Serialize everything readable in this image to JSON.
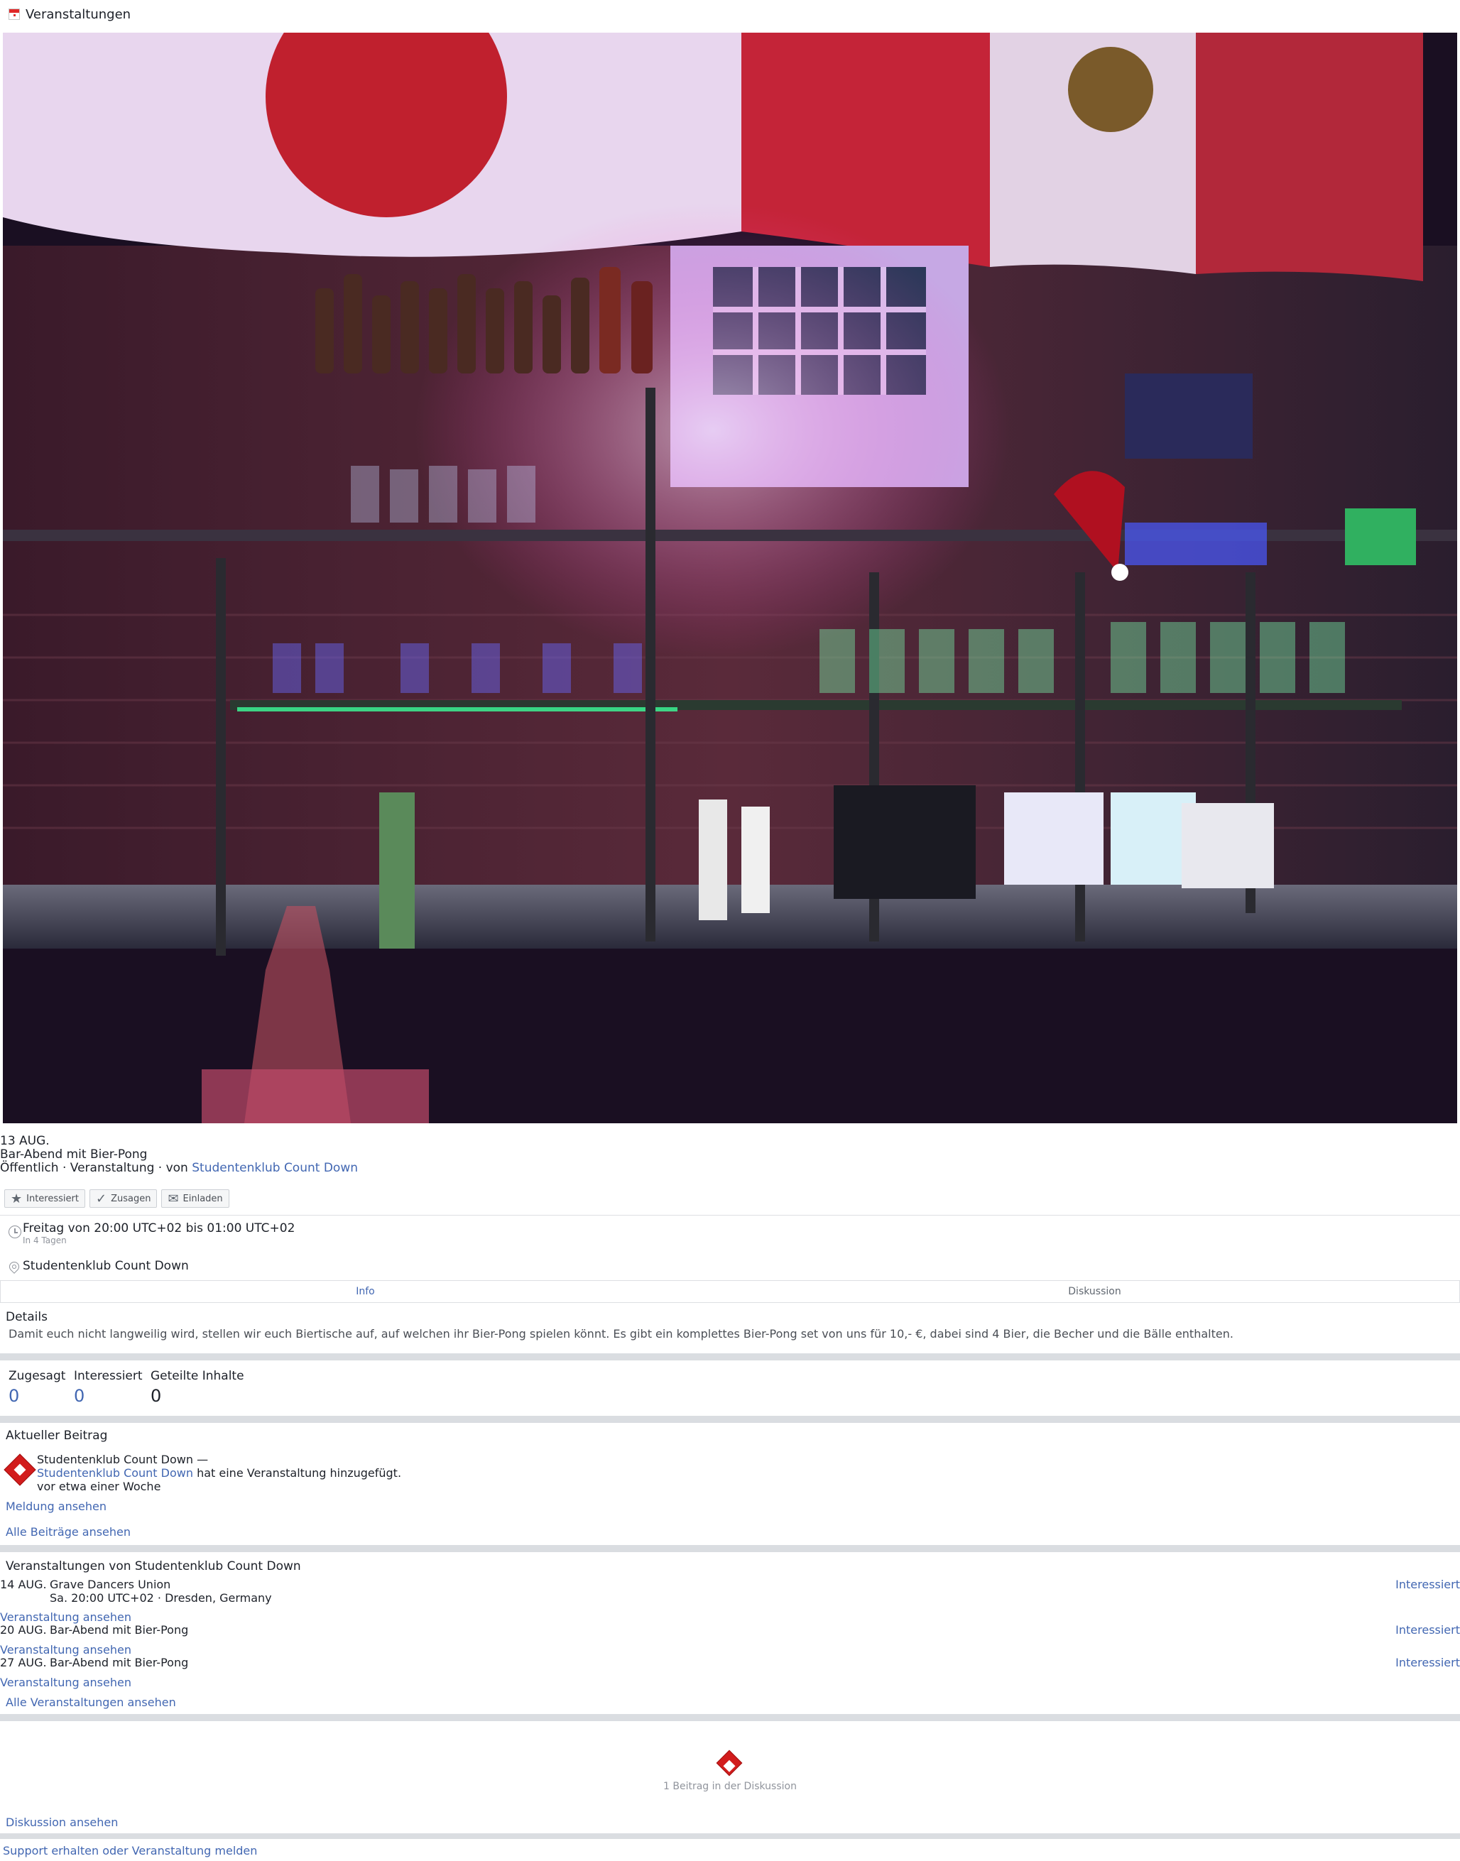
{
  "header": {
    "title": "Veranstaltungen",
    "icon": "calendar-icon"
  },
  "event": {
    "date": "13 AUG.",
    "title": "Bar-Abend mit Bier-Pong",
    "meta_prefix": "Öffentlich · Veranstaltung · von ",
    "organizer": "Studentenklub Count Down"
  },
  "actions": {
    "interested": "Interessiert",
    "going": "Zusagen",
    "invite": "Einladen"
  },
  "time": {
    "main": "Freitag von 20:00 UTC+02 bis 01:00 UTC+02",
    "relative": "In 4 Tagen"
  },
  "location": {
    "name": "Studentenklub Count Down"
  },
  "tabs": {
    "info": "Info",
    "discussion": "Diskussion"
  },
  "details": {
    "title": "Details",
    "text": "Damit euch nicht langweilig wird, stellen wir euch Biertische auf, auf welchen ihr Bier-Pong spielen könnt. Es gibt ein komplettes Bier-Pong set von uns für 10,- €, dabei sind 4 Bier, die Becher und die Bälle enthalten."
  },
  "stats": {
    "going_label": "Zugesagt",
    "going_value": "0",
    "interested_label": "Interessiert",
    "interested_value": "0",
    "shared_label": "Geteilte Inhalte",
    "shared_value": "0"
  },
  "recent_post": {
    "title": "Aktueller Beitrag",
    "author": "Studentenklub Count Down —",
    "author_link": "Studentenklub Count Down",
    "action": " hat eine Veranstaltung hinzugefügt.",
    "time": "vor etwa einer Woche",
    "view_link": "Meldung ansehen",
    "all_link": "Alle Beiträge ansehen"
  },
  "other_events": {
    "title": "Veranstaltungen von Studentenklub Count Down",
    "items": [
      {
        "date": "14 AUG.",
        "name": "Grave Dancers Union",
        "sub": "Sa. 20:00 UTC+02 · Dresden, Germany",
        "action": "Interessiert",
        "link": "Veranstaltung ansehen"
      },
      {
        "date": "20 AUG.",
        "name": "Bar-Abend mit Bier-Pong",
        "sub": "",
        "action": "Interessiert",
        "link": "Veranstaltung ansehen"
      },
      {
        "date": "27 AUG.",
        "name": "Bar-Abend mit Bier-Pong",
        "sub": "",
        "action": "Interessiert",
        "link": "Veranstaltung ansehen"
      }
    ],
    "all_link": "Alle Veranstaltungen ansehen"
  },
  "discussion": {
    "count_text": "1 Beitrag in der Diskussion",
    "view_link": "Diskussion ansehen"
  },
  "footer": {
    "support_link": "Support erhalten oder Veranstaltung melden"
  },
  "colors": {
    "link": "#4267b2",
    "brand_red": "#d21c1c",
    "separator": "#dadde1"
  }
}
